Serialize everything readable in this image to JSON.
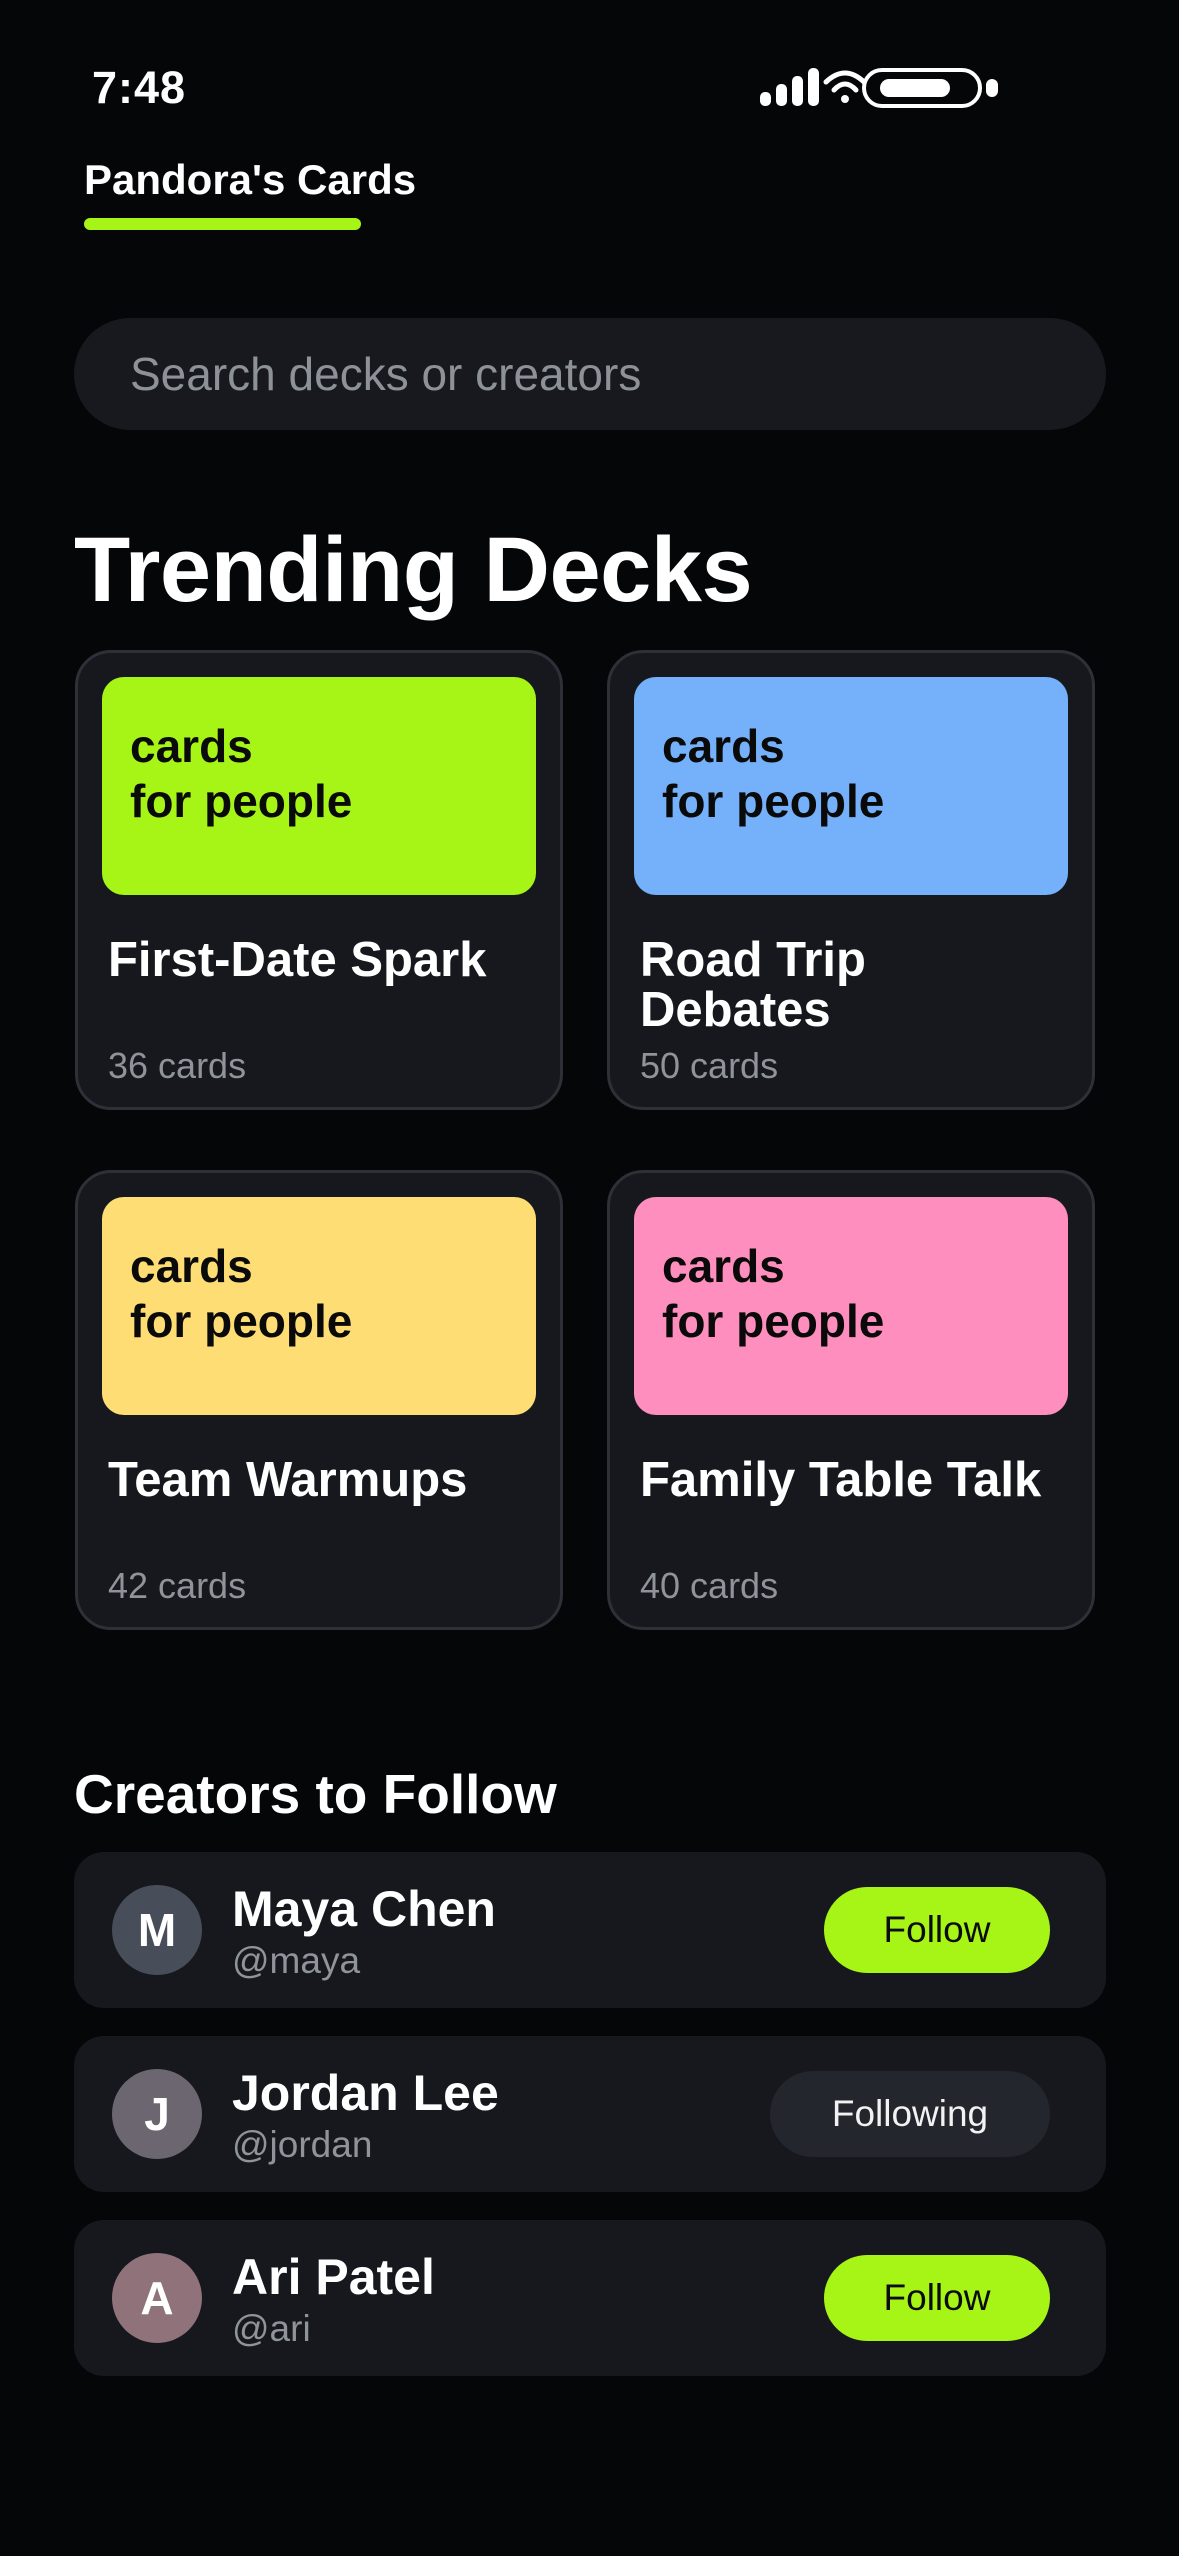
{
  "status_bar": {
    "time": "7:48",
    "icons": [
      "signal-icon",
      "wifi-icon",
      "battery-icon"
    ]
  },
  "brand": {
    "tab_label": "Pandora's Cards",
    "accent_color": "#a6f516"
  },
  "search": {
    "placeholder": "Search decks or creators",
    "value": ""
  },
  "trending": {
    "title": "Trending Decks",
    "decks": [
      {
        "cover_text": "cards\nfor people",
        "cover_color": "#a6f516",
        "title": "First-Date Spark",
        "count": "36 cards"
      },
      {
        "cover_text": "cards\nfor people",
        "cover_color": "#75b0fa",
        "title": "Road Trip Debates",
        "count": "50 cards"
      },
      {
        "cover_text": "cards\nfor people",
        "cover_color": "#fedd75",
        "title": "Team Warmups",
        "count": "42 cards"
      },
      {
        "cover_text": "cards\nfor people",
        "cover_color": "#fe8ebd",
        "title": "Family Table Talk",
        "count": "40 cards"
      }
    ]
  },
  "creators": {
    "title": "Creators to Follow",
    "items": [
      {
        "initial": "M",
        "avatar_color": "#474d59",
        "name": "Maya Chen",
        "handle": "@maya",
        "button_label": "Follow",
        "state": "follow"
      },
      {
        "initial": "J",
        "avatar_color": "#6b6670",
        "name": "Jordan Lee",
        "handle": "@jordan",
        "button_label": "Following",
        "state": "following"
      },
      {
        "initial": "A",
        "avatar_color": "#8f727a",
        "name": "Ari Patel",
        "handle": "@ari",
        "button_label": "Follow",
        "state": "follow"
      }
    ]
  }
}
